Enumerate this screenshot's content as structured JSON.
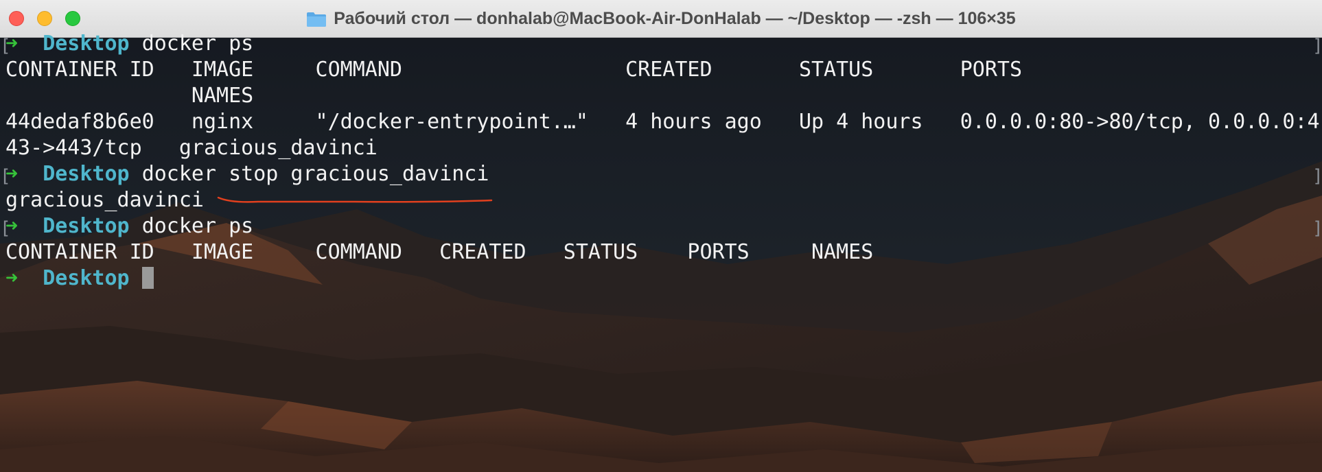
{
  "window": {
    "title": "Рабочий стол — donhalab@MacBook-Air-DonHalab — ~/Desktop — -zsh — 106×35",
    "folder_icon": "folder-icon",
    "colors": {
      "background": "#1a1e24",
      "prompt_arrow": "#36c23a",
      "prompt_dir": "#4fb6cc",
      "text": "#f2f2f2",
      "annotation_underline": "#e2401e"
    }
  },
  "terminal": {
    "lines": [
      {
        "kind": "prompt",
        "arrow": "➜",
        "dir": "Desktop",
        "cmd": "docker ps"
      },
      {
        "kind": "output",
        "text": "CONTAINER ID   IMAGE     COMMAND                  CREATED       STATUS       PORTS"
      },
      {
        "kind": "output",
        "text": "               NAMES"
      },
      {
        "kind": "output",
        "text": "44dedaf8b6e0   nginx     \"/docker-entrypoint.…\"   4 hours ago   Up 4 hours   0.0.0.0:80->80/tcp, 0.0.0.0:4"
      },
      {
        "kind": "output",
        "text": "43->443/tcp   gracious_davinci"
      },
      {
        "kind": "prompt",
        "arrow": "➜",
        "dir": "Desktop",
        "cmd": "docker stop gracious_davinci"
      },
      {
        "kind": "output",
        "text": "gracious_davinci"
      },
      {
        "kind": "prompt",
        "arrow": "➜",
        "dir": "Desktop",
        "cmd": "docker ps"
      },
      {
        "kind": "output",
        "text": "CONTAINER ID   IMAGE     COMMAND   CREATED   STATUS    PORTS     NAMES"
      },
      {
        "kind": "prompt",
        "arrow": "➜",
        "dir": "Desktop",
        "cmd": ""
      }
    ],
    "bracket_left": "[",
    "bracket_right": "]"
  }
}
